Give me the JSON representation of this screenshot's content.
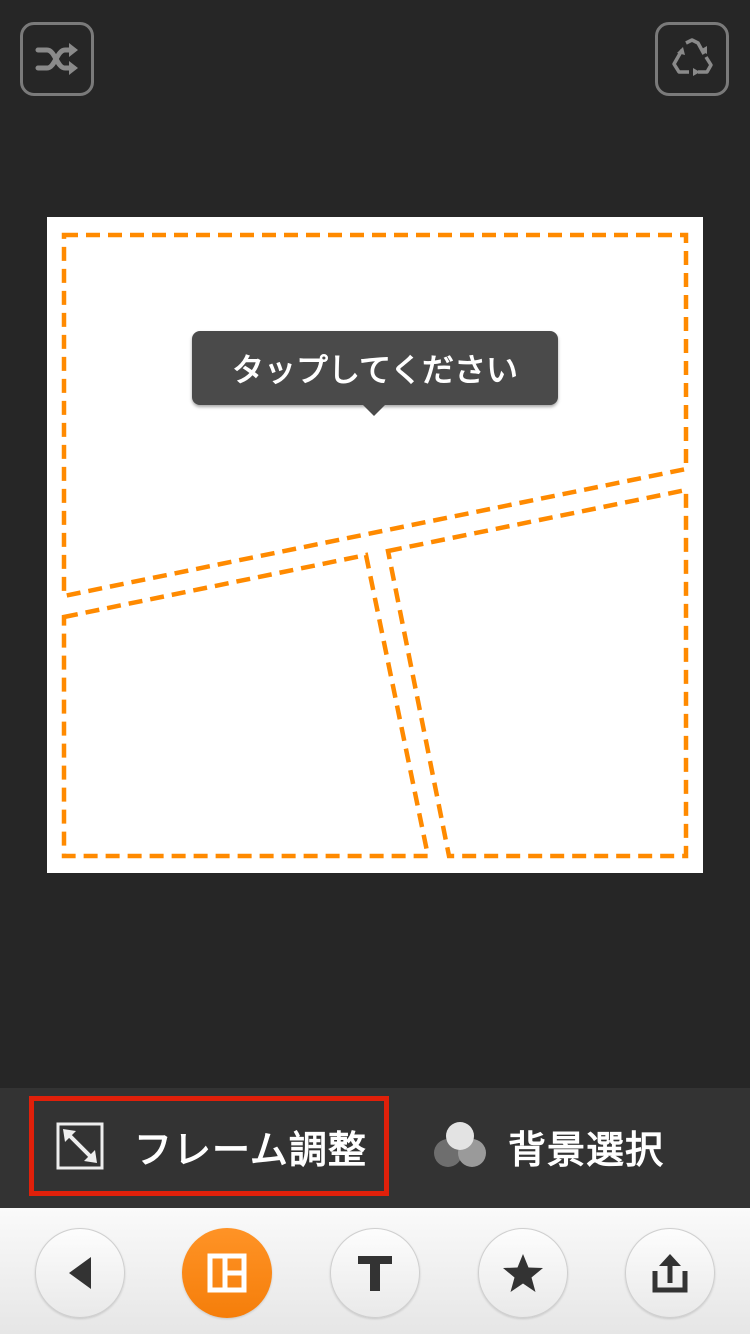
{
  "top_bar": {
    "shuffle_icon": "shuffle-icon",
    "recycle_icon": "recycle-icon"
  },
  "canvas": {
    "tooltip_text": "タップしてください",
    "frame_color": "#ff8a00"
  },
  "tool_bar": {
    "frame_adjust_label": "フレーム調整",
    "frame_adjust_icon": "resize-diagonal-icon",
    "background_select_label": "背景選択",
    "background_select_icon": "color-circles-icon",
    "highlight_color": "#e0200a"
  },
  "bottom_nav": {
    "items": [
      {
        "icon": "back-arrow-icon",
        "active": false
      },
      {
        "icon": "layout-icon",
        "active": true
      },
      {
        "icon": "text-icon",
        "active": false
      },
      {
        "icon": "star-icon",
        "active": false
      },
      {
        "icon": "share-icon",
        "active": false
      }
    ],
    "active_color": "#f57e0a"
  }
}
